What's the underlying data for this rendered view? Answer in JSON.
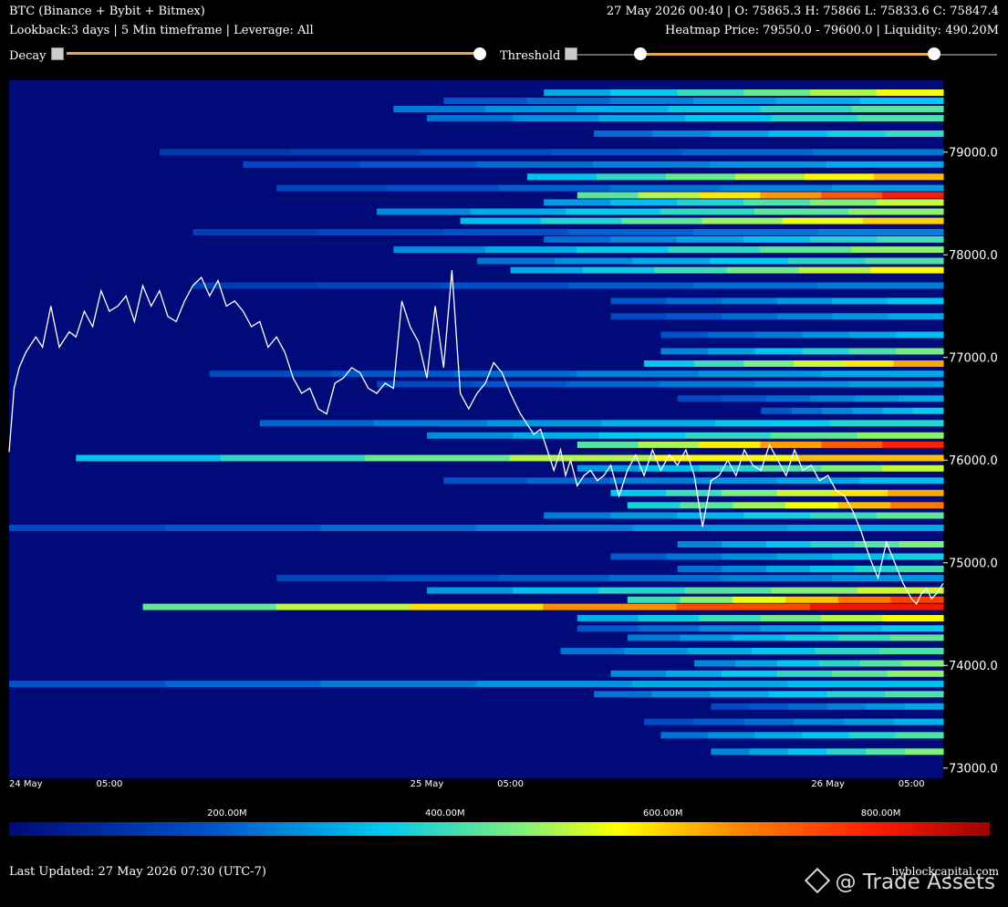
{
  "header": {
    "title": "BTC (Binance + Bybit + Bitmex)",
    "ohlc": "27 May 2026 00:40 | O: 75865.3 H: 75866 L: 75833.6 C: 75847.4",
    "params": "Lookback:3 days | 5 Min timeframe | Leverage: All",
    "heatmap_info": "Heatmap Price: 79550.0 - 79600.0 | Liquidity: 490.20M"
  },
  "controls": {
    "decay_label": "Decay",
    "threshold_label": "Threshold",
    "decay_value": 1.0,
    "threshold_range": [
      0.15,
      0.85
    ]
  },
  "colors": {
    "background": "#000a78",
    "price_line": "#ffffff",
    "slider_fill": "#e8a64a"
  },
  "chart_data": {
    "type": "heatmap",
    "x_tick_labels": [
      "24 May",
      "05:00",
      "25 May",
      "05:00",
      "26 May",
      "05:00"
    ],
    "x_tick_hours": [
      0,
      5,
      24,
      29,
      48,
      53
    ],
    "x_range_hours": [
      -1.0,
      54.9
    ],
    "ylim": [
      72900,
      79700
    ],
    "y_ticks": [
      73000,
      74000,
      75000,
      76000,
      77000,
      78000,
      79000
    ],
    "y_tick_labels": [
      "73000.0",
      "74000.0",
      "75000.0",
      "76000.0",
      "77000.0",
      "78000.0",
      "79000.0"
    ],
    "colorbar": {
      "range": [
        0,
        900
      ],
      "ticks": [
        200,
        400,
        600,
        800
      ],
      "tick_labels": [
        "200.00M",
        "400.00M",
        "600.00M",
        "800.00M"
      ]
    },
    "liquidity_bands": [
      {
        "price": 79580,
        "start": 31.0,
        "value": 550
      },
      {
        "price": 79500,
        "start": 25.0,
        "value": 340
      },
      {
        "price": 79420,
        "start": 22.0,
        "value": 430
      },
      {
        "price": 79330,
        "start": 24.0,
        "value": 420
      },
      {
        "price": 79180,
        "start": 34.0,
        "value": 400
      },
      {
        "price": 79000,
        "start": 8.0,
        "value": 230
      },
      {
        "price": 78880,
        "start": 13.0,
        "value": 300
      },
      {
        "price": 78760,
        "start": 30.0,
        "value": 620
      },
      {
        "price": 78650,
        "start": 15.0,
        "value": 280
      },
      {
        "price": 78580,
        "start": 33.0,
        "value": 800
      },
      {
        "price": 78510,
        "start": 31.0,
        "value": 520
      },
      {
        "price": 78420,
        "start": 21.0,
        "value": 480
      },
      {
        "price": 78330,
        "start": 26.0,
        "value": 600
      },
      {
        "price": 78220,
        "start": 10.0,
        "value": 250
      },
      {
        "price": 78150,
        "start": 31.0,
        "value": 410
      },
      {
        "price": 78050,
        "start": 22.0,
        "value": 480
      },
      {
        "price": 77940,
        "start": 27.0,
        "value": 420
      },
      {
        "price": 77850,
        "start": 29.0,
        "value": 560
      },
      {
        "price": 77700,
        "start": 10.0,
        "value": 240
      },
      {
        "price": 77550,
        "start": 35.0,
        "value": 340
      },
      {
        "price": 77400,
        "start": 35.0,
        "value": 300
      },
      {
        "price": 77220,
        "start": 38.0,
        "value": 330
      },
      {
        "price": 77060,
        "start": 38.0,
        "value": 460
      },
      {
        "price": 76940,
        "start": 37.0,
        "value": 640
      },
      {
        "price": 76840,
        "start": 11.0,
        "value": 300
      },
      {
        "price": 76740,
        "start": 21.0,
        "value": 290
      },
      {
        "price": 76600,
        "start": 39.0,
        "value": 300
      },
      {
        "price": 76480,
        "start": 44.0,
        "value": 350
      },
      {
        "price": 76360,
        "start": 14.0,
        "value": 380
      },
      {
        "price": 76240,
        "start": 24.0,
        "value": 480
      },
      {
        "price": 76150,
        "start": 33.0,
        "value": 790
      },
      {
        "price": 76020,
        "start": 3.0,
        "value": 620
      },
      {
        "price": 75920,
        "start": 33.0,
        "value": 520
      },
      {
        "price": 75800,
        "start": 25.0,
        "value": 330
      },
      {
        "price": 75680,
        "start": 35.0,
        "value": 640
      },
      {
        "price": 75560,
        "start": 36.0,
        "value": 680
      },
      {
        "price": 75460,
        "start": 31.0,
        "value": 440
      },
      {
        "price": 75340,
        "start": -1.0,
        "value": 300
      },
      {
        "price": 75180,
        "start": 39.0,
        "value": 470
      },
      {
        "price": 75060,
        "start": 35.0,
        "value": 360
      },
      {
        "price": 74940,
        "start": 39.0,
        "value": 410
      },
      {
        "price": 74850,
        "start": 15.0,
        "value": 270
      },
      {
        "price": 74730,
        "start": 24.0,
        "value": 520
      },
      {
        "price": 74640,
        "start": 36.0,
        "value": 750
      },
      {
        "price": 74570,
        "start": 7.0,
        "value": 810
      },
      {
        "price": 74460,
        "start": 33.0,
        "value": 560
      },
      {
        "price": 74360,
        "start": 33.0,
        "value": 350
      },
      {
        "price": 74270,
        "start": 36.0,
        "value": 440
      },
      {
        "price": 74140,
        "start": 32.0,
        "value": 420
      },
      {
        "price": 74020,
        "start": 40.0,
        "value": 470
      },
      {
        "price": 73920,
        "start": 35.0,
        "value": 480
      },
      {
        "price": 73820,
        "start": -1.0,
        "value": 330
      },
      {
        "price": 73720,
        "start": 34.0,
        "value": 420
      },
      {
        "price": 73600,
        "start": 41.0,
        "value": 300
      },
      {
        "price": 73450,
        "start": 37.0,
        "value": 310
      },
      {
        "price": 73320,
        "start": 38.0,
        "value": 420
      },
      {
        "price": 73160,
        "start": 41.0,
        "value": 470
      }
    ],
    "price_series": {
      "hours": [
        -1.0,
        -0.7,
        -0.4,
        0.0,
        0.6,
        1.0,
        1.5,
        2.0,
        2.6,
        3.0,
        3.5,
        4.0,
        4.5,
        5.0,
        5.5,
        6.0,
        6.5,
        7.0,
        7.5,
        8.0,
        8.5,
        9.0,
        9.5,
        10.0,
        10.5,
        11.0,
        11.5,
        12.0,
        12.5,
        13.0,
        13.5,
        14.0,
        14.5,
        15.0,
        15.5,
        16.0,
        16.5,
        17.0,
        17.5,
        18.0,
        18.5,
        19.0,
        19.5,
        20.0,
        20.5,
        21.0,
        21.5,
        22.0,
        22.5,
        23.0,
        23.5,
        24.0,
        24.5,
        25.0,
        25.5,
        26.0,
        26.5,
        27.0,
        27.5,
        28.0,
        28.5,
        29.0,
        29.3,
        29.6,
        30.0,
        30.4,
        30.8,
        31.2,
        31.6,
        32.0,
        32.3,
        32.6,
        33.0,
        33.4,
        33.8,
        34.2,
        34.6,
        35.0,
        35.5,
        36.0,
        36.5,
        37.0,
        37.5,
        38.0,
        38.5,
        39.0,
        39.5,
        40.0,
        40.5,
        41.0,
        41.5,
        42.0,
        42.5,
        43.0,
        43.5,
        44.0,
        44.5,
        45.0,
        45.5,
        46.0,
        46.5,
        47.0,
        47.5,
        48.0,
        48.5,
        49.0,
        49.5,
        50.0,
        50.5,
        51.0,
        51.5,
        52.0,
        52.5,
        53.0,
        53.3,
        53.6,
        53.9,
        54.2,
        54.5,
        54.9
      ],
      "prices": [
        76080,
        76700,
        76900,
        77050,
        77200,
        77100,
        77500,
        77100,
        77250,
        77200,
        77450,
        77300,
        77650,
        77450,
        77500,
        77600,
        77350,
        77700,
        77500,
        77650,
        77400,
        77350,
        77550,
        77700,
        77780,
        77600,
        77750,
        77500,
        77550,
        77450,
        77300,
        77350,
        77100,
        77200,
        77050,
        76800,
        76650,
        76700,
        76500,
        76450,
        76750,
        76800,
        76900,
        76850,
        76700,
        76650,
        76750,
        76700,
        77550,
        77300,
        77150,
        76800,
        77500,
        76900,
        77850,
        76650,
        76500,
        76650,
        76750,
        76950,
        76850,
        76650,
        76550,
        76450,
        76350,
        76250,
        76300,
        76100,
        75900,
        76100,
        75850,
        76000,
        75750,
        75850,
        75900,
        75800,
        75850,
        75950,
        75650,
        75900,
        76050,
        75850,
        76100,
        75900,
        76050,
        75950,
        76100,
        75850,
        75350,
        75800,
        75850,
        76000,
        75850,
        76100,
        75950,
        75900,
        76150,
        76000,
        75850,
        76100,
        75900,
        75950,
        75800,
        75850,
        75700,
        75650,
        75500,
        75300,
        75050,
        74850,
        75200,
        75000,
        74800,
        74650,
        74600,
        74700,
        74750,
        74650,
        74700,
        74800
      ]
    }
  }
}
